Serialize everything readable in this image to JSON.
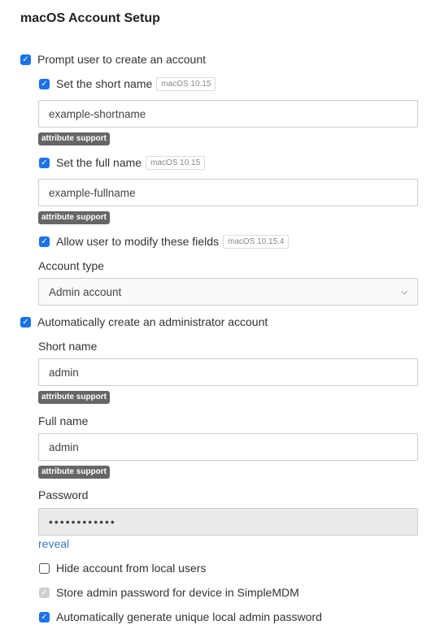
{
  "title": "macOS Account Setup",
  "prompt_user": {
    "label": "Prompt user to create an account",
    "checked": true
  },
  "short_name_toggle": {
    "label": "Set the short name",
    "badge": "macOS 10.15",
    "checked": true,
    "value": "example-shortname"
  },
  "full_name_toggle": {
    "label": "Set the full name",
    "badge": "macOS 10.15",
    "checked": true,
    "value": "example-fullname"
  },
  "allow_modify": {
    "label": "Allow user to modify these fields",
    "badge": "macOS 10.15.4",
    "checked": true
  },
  "attribute_badge": "attribute support",
  "account_type": {
    "label": "Account type",
    "value": "Admin account"
  },
  "auto_admin": {
    "label": "Automatically create an administrator account",
    "checked": true
  },
  "admin_short_name": {
    "label": "Short name",
    "value": "admin"
  },
  "admin_full_name": {
    "label": "Full name",
    "value": "admin"
  },
  "password": {
    "label": "Password",
    "value": "••••••••••••",
    "reveal": "reveal"
  },
  "hide_account": {
    "label": "Hide account from local users",
    "checked": false
  },
  "store_password": {
    "label": "Store admin password for device in SimpleMDM",
    "checked": true,
    "disabled": true
  },
  "auto_generate": {
    "label": "Automatically generate unique local admin password",
    "checked": true
  },
  "colors": {
    "accent": "#1a73e8",
    "link": "#3a7bbf",
    "badge": "#666666"
  }
}
